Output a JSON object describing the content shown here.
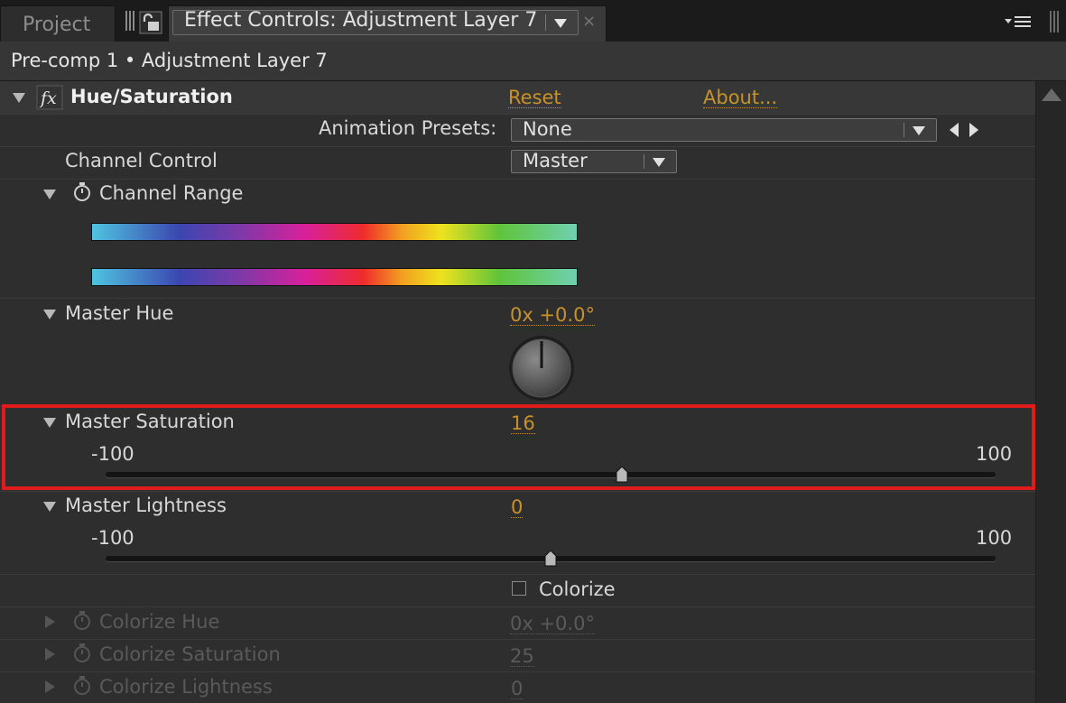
{
  "tabs": {
    "project_label": "Project",
    "effect_controls_label": "Effect Controls: Adjustment Layer 7",
    "close_glyph": "×"
  },
  "breadcrumb": "Pre-comp 1 • Adjustment Layer 7",
  "effect": {
    "fx_glyph": "fx",
    "name": "Hue/Saturation",
    "reset_label": "Reset",
    "about_label": "About...",
    "animation_presets_label": "Animation Presets:",
    "animation_presets_value": "None",
    "channel_control_label": "Channel Control",
    "channel_control_value": "Master",
    "channel_range_label": "Channel Range",
    "master_hue_label": "Master Hue",
    "master_hue_value": "0x +0.0°",
    "master_saturation_label": "Master Saturation",
    "master_saturation_value": "16",
    "master_saturation_min": "-100",
    "master_saturation_max": "100",
    "master_saturation_level": 16,
    "master_lightness_label": "Master Lightness",
    "master_lightness_value": "0",
    "master_lightness_min": "-100",
    "master_lightness_max": "100",
    "master_lightness_level": 0,
    "colorize_label": "Colorize",
    "colorize_checked": false,
    "colorize_hue_label": "Colorize Hue",
    "colorize_hue_value": "0x +0.0°",
    "colorize_saturation_label": "Colorize Saturation",
    "colorize_saturation_value": "25",
    "colorize_lightness_label": "Colorize Lightness",
    "colorize_lightness_value": "0"
  },
  "colors": {
    "value_orange": "#c8922a",
    "highlight_red": "#e01b1b",
    "panel_bg": "#2e2e2e"
  },
  "icons": [
    "lock-icon",
    "panel-menu-icon",
    "stopwatch-icon",
    "fx-icon",
    "twirl-triangle-icon",
    "hue-dial-icon",
    "scroll-up-icon"
  ]
}
